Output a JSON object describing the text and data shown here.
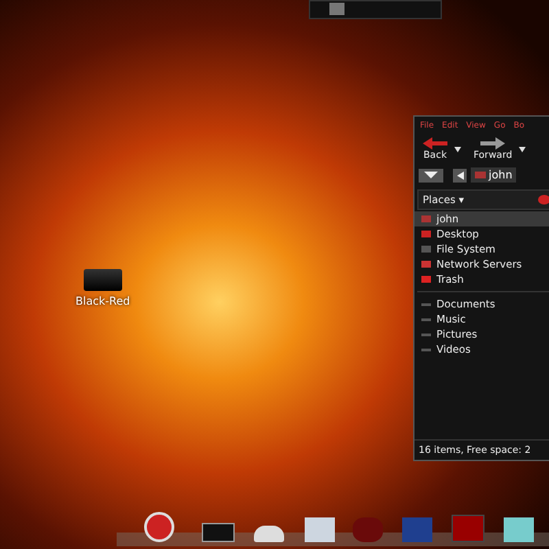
{
  "desktop_icons": [
    {
      "label": "Black-Red"
    }
  ],
  "file_manager": {
    "menu": [
      "File",
      "Edit",
      "View",
      "Go",
      "Bo"
    ],
    "toolbar": [
      {
        "label": "Back",
        "kind": "back"
      },
      {
        "label": "Forward",
        "kind": "forward"
      }
    ],
    "location": {
      "path_button": "john"
    },
    "sidebar": {
      "title": "Places ▾",
      "places": [
        {
          "label": "john",
          "kind": "home",
          "selected": true
        },
        {
          "label": "Desktop",
          "kind": "desktop",
          "selected": false
        },
        {
          "label": "File System",
          "kind": "filesystem",
          "selected": false
        },
        {
          "label": "Network Servers",
          "kind": "network",
          "selected": false
        },
        {
          "label": "Trash",
          "kind": "trash",
          "selected": false
        }
      ],
      "bookmarks": [
        {
          "label": "Documents",
          "selected": false
        },
        {
          "label": "Music",
          "selected": false
        },
        {
          "label": "Pictures",
          "selected": false
        },
        {
          "label": "Videos",
          "selected": false
        }
      ]
    },
    "status_bar": "16 items, Free space: 2"
  }
}
